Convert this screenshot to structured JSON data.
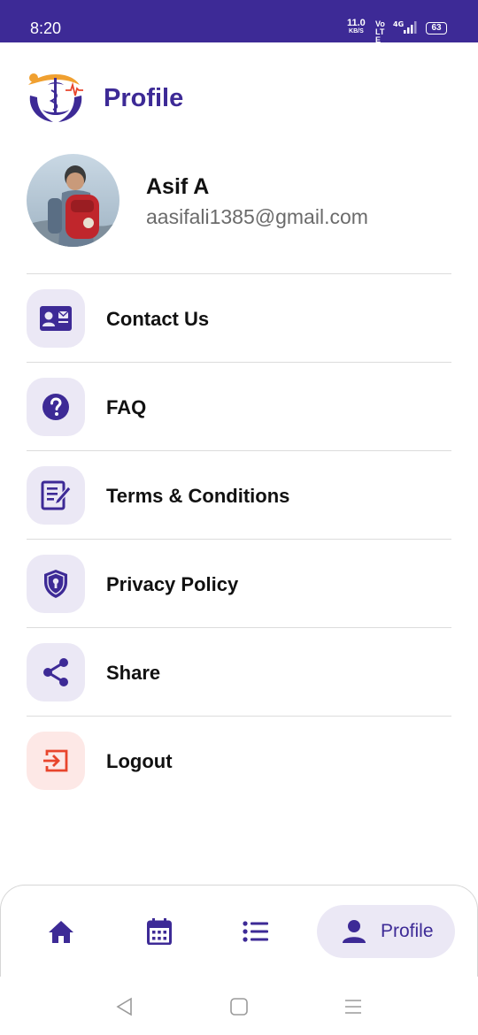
{
  "status_bar": {
    "time": "8:20",
    "speed_value": "11.0",
    "speed_unit": "KB/S",
    "volte": "Vo LTE",
    "network": "4G",
    "battery": "63"
  },
  "header": {
    "title": "Profile"
  },
  "profile": {
    "name": "Asif A",
    "email": "aasifali1385@gmail.com"
  },
  "menu": {
    "items": [
      {
        "label": "Contact Us",
        "icon": "contact-card-icon"
      },
      {
        "label": "FAQ",
        "icon": "question-icon"
      },
      {
        "label": "Terms & Conditions",
        "icon": "document-edit-icon"
      },
      {
        "label": "Privacy Policy",
        "icon": "shield-lock-icon"
      },
      {
        "label": "Share",
        "icon": "share-icon"
      },
      {
        "label": "Logout",
        "icon": "logout-icon"
      }
    ]
  },
  "bottom_nav": {
    "items": [
      {
        "icon": "home-icon"
      },
      {
        "icon": "calendar-icon"
      },
      {
        "icon": "list-icon"
      },
      {
        "icon": "person-icon",
        "label": "Profile",
        "active": true
      }
    ]
  },
  "colors": {
    "primary": "#3d2a96",
    "icon_bg": "#ebe8f5",
    "danger": "#e8452c",
    "danger_bg": "#fde8e6"
  }
}
